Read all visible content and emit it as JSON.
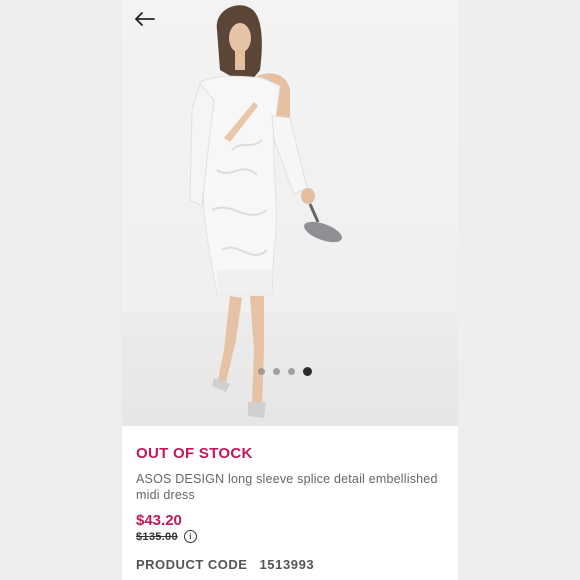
{
  "product": {
    "stock_status": "OUT OF STOCK",
    "title": "ASOS DESIGN long sleeve splice detail embellished midi dress",
    "price": "$43.20",
    "was_price": "$135.00",
    "code_label": "PRODUCT CODE",
    "code_value": "1513993"
  },
  "gallery": {
    "image_count": 4,
    "active_index": 3
  },
  "icons": {
    "back": "arrow-left-icon",
    "info": "info-icon"
  },
  "colors": {
    "accent": "#c2185b",
    "text": "#666666",
    "background": "#ffffff"
  }
}
